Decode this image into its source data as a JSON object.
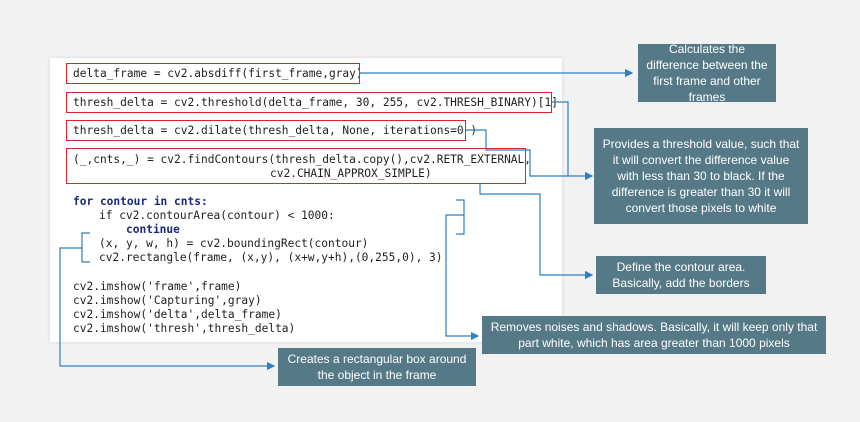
{
  "code": {
    "line1": "delta_frame = cv2.absdiff(first_frame,gray)",
    "line2": "thresh_delta = cv2.threshold(delta_frame, 30, 255, cv2.THRESH_BINARY)[1]",
    "line3": "thresh_delta = cv2.dilate(thresh_delta, None, iterations=0 )",
    "line4a": "(_,cnts,_) = cv2.findContours(thresh_delta.copy(),cv2.RETR_EXTERNAL,",
    "line4b": "cv2.CHAIN_APPROX_SIMPLE)",
    "line5": "for contour in cnts:",
    "line6": "if cv2.contourArea(contour) < 1000:",
    "line7": "continue",
    "line8": "(x, y, w, h) = cv2.boundingRect(contour)",
    "line9": "cv2.rectangle(frame, (x,y), (x+w,y+h),(0,255,0), 3)",
    "line10": "cv2.imshow('frame',frame)",
    "line11": "cv2.imshow('Capturing',gray)",
    "line12": "cv2.imshow('delta',delta_frame)",
    "line13": "cv2.imshow('thresh',thresh_delta)"
  },
  "callouts": {
    "absdiff": "Calculates the difference between the first frame and other frames",
    "threshold": "Provides a threshold value, such that it will convert the difference value with less than 30 to black. If the difference is greater than 30 it will convert those pixels to white",
    "contour_area": "Define the contour area. Basically, add the borders",
    "noise": "Removes noises and shadows. Basically, it will keep only that part white, which has area greater than 1000 pixels",
    "rectangle": "Creates a rectangular box around the object in the frame"
  },
  "colors": {
    "callout_bg": "#567987",
    "highlight_border": "#d9232d",
    "connector": "#2f7fc1"
  }
}
